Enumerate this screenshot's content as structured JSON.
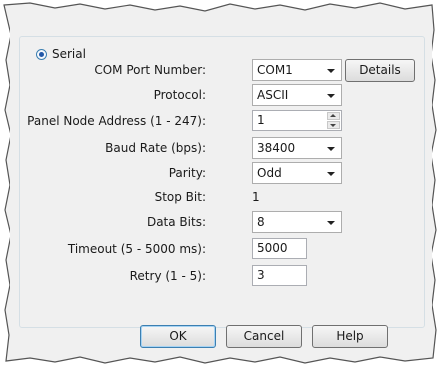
{
  "serial": {
    "label": "Serial",
    "selected": true
  },
  "fields": {
    "com_port": {
      "label": "COM Port Number:",
      "value": "COM1"
    },
    "protocol": {
      "label": "Protocol:",
      "value": "ASCII"
    },
    "node_address": {
      "label": "Panel Node Address (1 - 247):",
      "value": "1"
    },
    "baud_rate": {
      "label": "Baud Rate (bps):",
      "value": "38400"
    },
    "parity": {
      "label": "Parity:",
      "value": "Odd"
    },
    "stop_bit": {
      "label": "Stop Bit:",
      "value": "1"
    },
    "data_bits": {
      "label": "Data Bits:",
      "value": "8"
    },
    "timeout": {
      "label": "Timeout (5 - 5000 ms):",
      "value": "5000"
    },
    "retry": {
      "label": "Retry (1 - 5):",
      "value": "3"
    }
  },
  "buttons": {
    "details": "Details",
    "ok": "OK",
    "cancel": "Cancel",
    "help": "Help"
  }
}
